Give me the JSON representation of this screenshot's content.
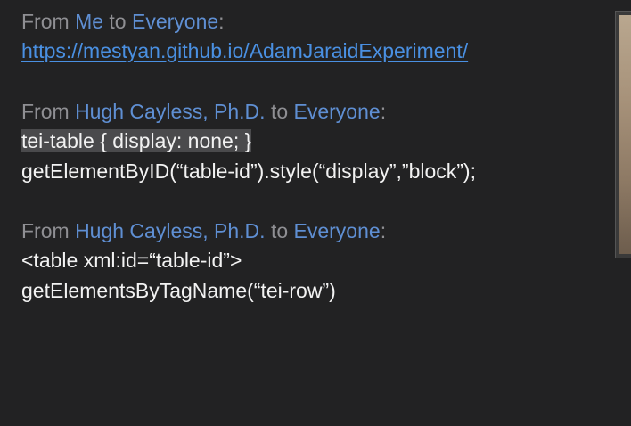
{
  "chat": {
    "messages": [
      {
        "from_word": "From",
        "sender": "Me",
        "to_word": "to",
        "recipient": "Everyone",
        "colon": ":",
        "link": "https://mestyan.github.io/AdamJaraidExperiment/"
      },
      {
        "from_word": "From",
        "sender": "Hugh Cayless, Ph.D.",
        "to_word": "to",
        "recipient": "Everyone",
        "colon": ":",
        "lines": [
          "tei-table { display: none; }",
          "getElementByID(“table-id”).style(“display”,”block”);"
        ]
      },
      {
        "from_word": "From",
        "sender": "Hugh Cayless, Ph.D.",
        "to_word": "to",
        "recipient": "Everyone",
        "colon": ":",
        "lines": [
          "<table xml:id=“table-id”>",
          "getElementsByTagName(“tei-row”)"
        ]
      }
    ]
  }
}
